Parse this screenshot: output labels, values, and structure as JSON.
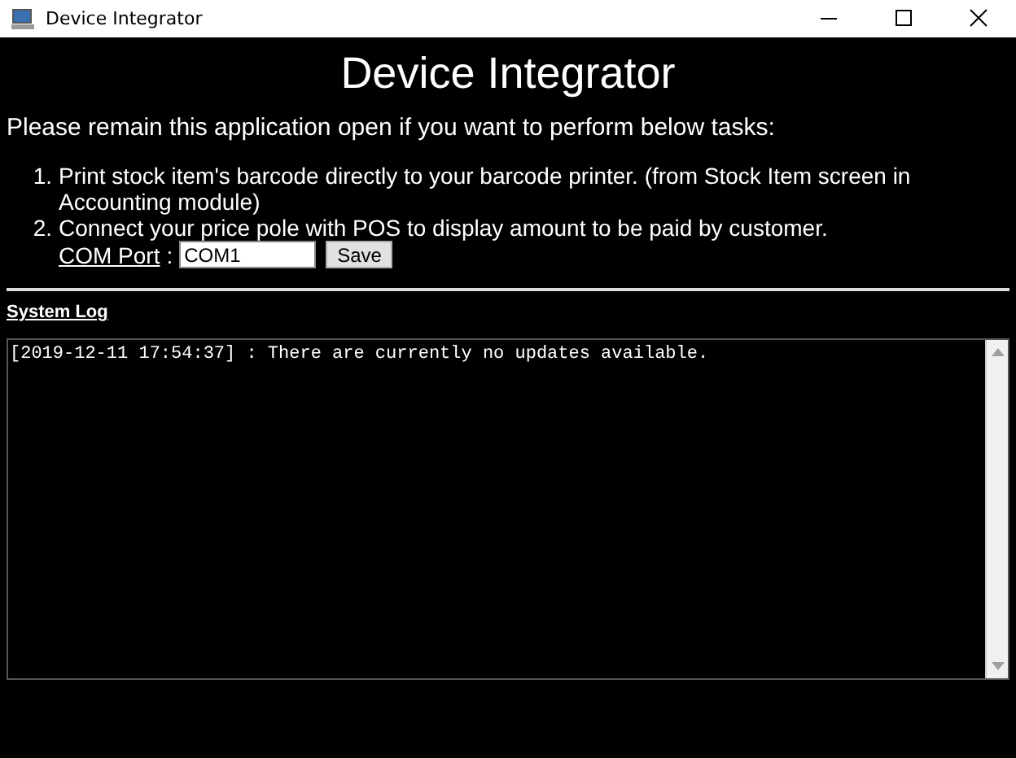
{
  "window": {
    "title": "Device Integrator"
  },
  "heading": "Device Integrator",
  "intro": "Please remain this application open if you want to perform below tasks:",
  "tasks": [
    {
      "number": "1.",
      "text": "Print stock item's barcode directly to your barcode printer. (from Stock Item screen in Accounting module)"
    },
    {
      "number": "2.",
      "text": "Connect your price pole with POS to display amount to be paid by customer."
    }
  ],
  "com_port": {
    "label": "COM Port",
    "separator": ":",
    "value": "COM1",
    "button": "Save"
  },
  "system_log": {
    "title": "System Log",
    "lines": [
      "[2019-12-11 17:54:37] : There are currently no updates available."
    ]
  }
}
